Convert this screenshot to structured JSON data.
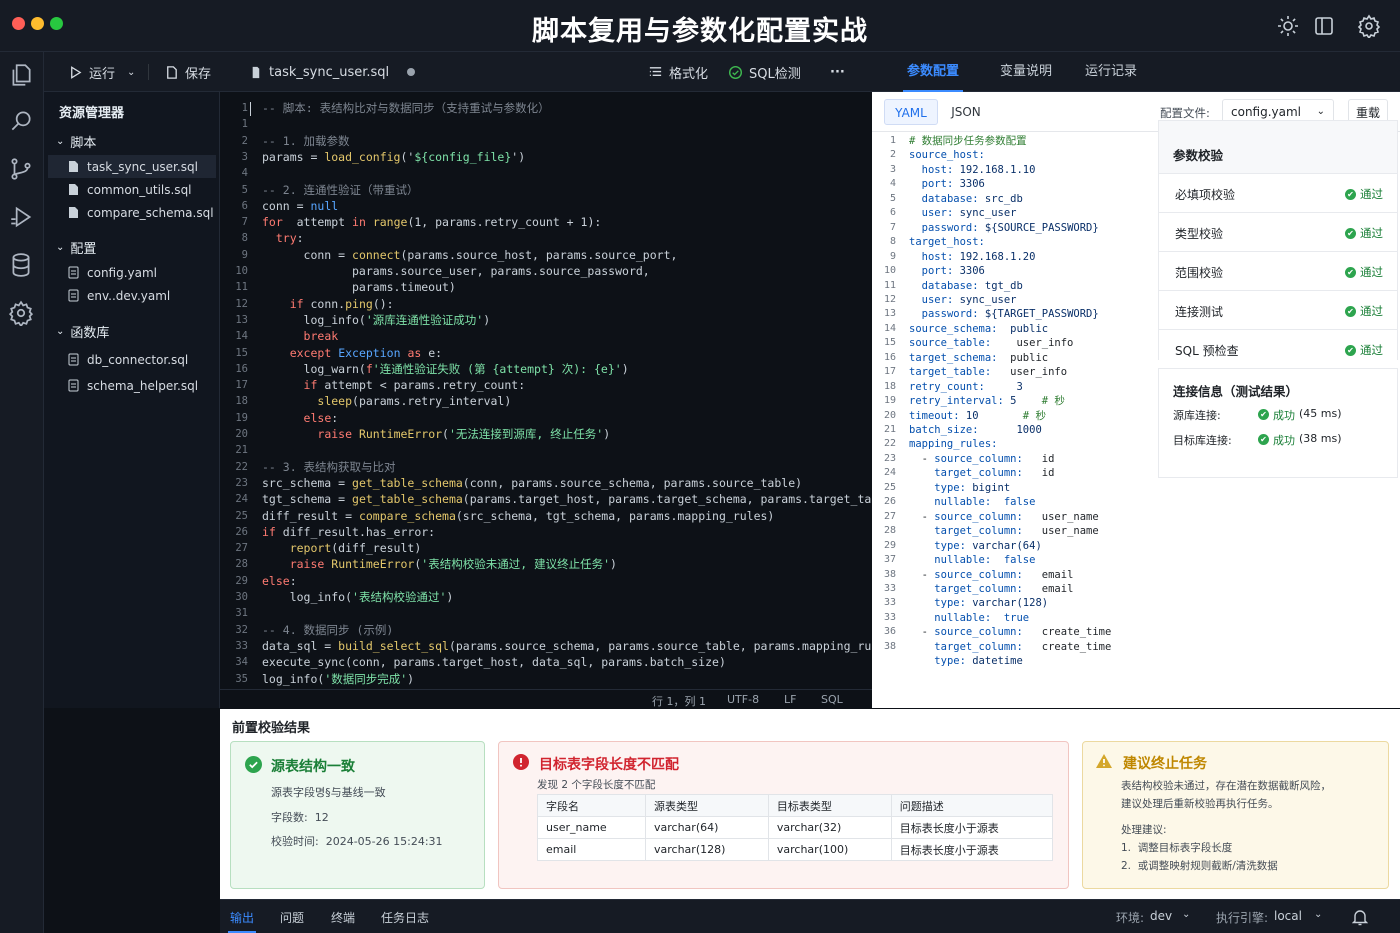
{
  "window": {
    "title": "脚本复用与参数化配置实战"
  },
  "colors": {
    "accent": "#3b8bff",
    "success": "#1a7f37",
    "error": "#d1242f",
    "warning": "#bf8700"
  },
  "toolbar": {
    "run_label": "运行",
    "save_label": "保存",
    "file_tab": "task_sync_user.sql",
    "format_label": "格式化",
    "sql_check_label": "SQL检测",
    "more_label": "···"
  },
  "right_tabs": [
    "参数配置",
    "变量说明",
    "运行记录"
  ],
  "sidebar": {
    "title": "资源管理器",
    "groups": [
      {
        "label": "脚本",
        "items": [
          "task_sync_user.sql",
          "common_utils.sql",
          "compare_schema.sql"
        ]
      },
      {
        "label": "配置",
        "items": [
          "config.yaml",
          "env..dev.yaml"
        ]
      },
      {
        "label": "函数库",
        "items": [
          "db_connector.sql",
          "schema_helper.sql"
        ]
      }
    ]
  },
  "editor": {
    "lines": [
      [
        [
          "c-com",
          "-- 脚本: 表结构比对与数据同步（支持重试与参数化）"
        ]
      ],
      [],
      [
        [
          "c-com",
          "-- 1. 加载参数"
        ]
      ],
      [
        [
          "",
          "params = "
        ],
        [
          "c-fn",
          "load_config"
        ],
        [
          "",
          "('"
        ],
        [
          "c-str",
          "${config_file}"
        ],
        [
          "",
          "')"
        ]
      ],
      [],
      [
        [
          "c-com",
          "-- 2. 连通性验证（带重试）"
        ]
      ],
      [
        [
          "",
          "conn = "
        ],
        [
          "c-bl",
          "null"
        ]
      ],
      [
        [
          "c-kw",
          "for"
        ],
        [
          "",
          "  attempt "
        ],
        [
          "c-kw",
          "in"
        ],
        [
          "",
          ""
        ],
        [
          "c-fn",
          " range"
        ],
        [
          "",
          "(1, params.retry_count + 1):"
        ]
      ],
      [
        [
          "",
          "  "
        ],
        [
          "c-kw",
          "try"
        ],
        [
          "",
          ":"
        ]
      ],
      [
        [
          "",
          "      conn = "
        ],
        [
          "c-fn",
          "connect"
        ],
        [
          "",
          "(params.source_host, params.source_port,"
        ]
      ],
      [
        [
          "",
          "             params.source_user, params.source_password,"
        ]
      ],
      [
        [
          "",
          "             params.timeout)"
        ]
      ],
      [
        [
          "",
          "    "
        ],
        [
          "c-kw",
          "if"
        ],
        [
          "",
          " conn."
        ],
        [
          "c-fn",
          "ping"
        ],
        [
          "",
          "():"
        ]
      ],
      [
        [
          "",
          "      log_info("
        ],
        [
          "c-str",
          "'源库连通性验证成功'"
        ],
        [
          "",
          ")"
        ]
      ],
      [
        [
          "",
          "      "
        ],
        [
          "c-kw",
          "break"
        ]
      ],
      [
        [
          "",
          "    "
        ],
        [
          "c-kw",
          "except"
        ],
        [
          "",
          " "
        ],
        [
          "c-bl",
          "Exception"
        ],
        [
          "",
          " "
        ],
        [
          "c-kw",
          "as"
        ],
        [
          "",
          " e:"
        ]
      ],
      [
        [
          "",
          "      log_warn("
        ],
        [
          "c-kw",
          "f"
        ],
        [
          "c-str",
          "'连通性验证失败 (第 {attempt} 次): {e}'"
        ],
        [
          "",
          ")"
        ]
      ],
      [
        [
          "",
          "      "
        ],
        [
          "c-kw",
          "if"
        ],
        [
          "",
          " attempt < params.retry_count:"
        ]
      ],
      [
        [
          "",
          "        "
        ],
        [
          "c-fn",
          "sleep"
        ],
        [
          "",
          "(params.retry_interval)"
        ]
      ],
      [
        [
          "",
          "      "
        ],
        [
          "c-kw",
          "else"
        ],
        [
          "",
          ":"
        ]
      ],
      [
        [
          "",
          "        "
        ],
        [
          "c-kw",
          "raise"
        ],
        [
          "",
          " "
        ],
        [
          "c-fn",
          "RuntimeError"
        ],
        [
          "",
          "("
        ],
        [
          "c-str",
          "'无法连接到源库, 终止任务'"
        ],
        [
          "",
          ")"
        ]
      ],
      [],
      [
        [
          "c-com",
          "-- 3. 表结构获取与比对"
        ]
      ],
      [
        [
          "",
          "src_schema = "
        ],
        [
          "c-fn",
          "get_table_schema"
        ],
        [
          "",
          "(conn, params.source_schema, params.source_table)"
        ]
      ],
      [
        [
          "",
          "tgt_schema = "
        ],
        [
          "c-fn",
          "get_table_schema"
        ],
        [
          "",
          "(params.target_host, params.target_schema, params.target_table)"
        ]
      ],
      [
        [
          "",
          "diff_result = "
        ],
        [
          "c-fn",
          "compare_schema"
        ],
        [
          "",
          "(src_schema, tgt_schema, params.mapping_rules)"
        ]
      ],
      [
        [
          "c-kw",
          "if"
        ],
        [
          "",
          " diff_result.has_error:"
        ]
      ],
      [
        [
          "",
          "    "
        ],
        [
          "c-fn",
          "report"
        ],
        [
          "",
          "(diff_result)"
        ]
      ],
      [
        [
          "",
          "    "
        ],
        [
          "c-kw",
          "raise"
        ],
        [
          "",
          " "
        ],
        [
          "c-fn",
          "RuntimeError"
        ],
        [
          "",
          "("
        ],
        [
          "c-str",
          "'表结构校验未通过, 建议终止任务'"
        ],
        [
          "",
          ")"
        ]
      ],
      [
        [
          "c-kw",
          "else"
        ],
        [
          "",
          ":"
        ]
      ],
      [
        [
          "",
          "    log_info("
        ],
        [
          "c-str",
          "'表结构校验通过'"
        ],
        [
          "",
          ")"
        ]
      ],
      [],
      [
        [
          "c-com",
          "-- 4. 数据同步 (示例)"
        ]
      ],
      [
        [
          "",
          "data_sql = "
        ],
        [
          "c-fn",
          "build_select_sql"
        ],
        [
          "",
          "(params.source_schema, params.source_table, params.mapping_rules)"
        ]
      ],
      [
        [
          "",
          "execute_sync(conn, params.target_host, data_sql, params.batch_size)"
        ]
      ],
      [
        [
          "",
          "log_info("
        ],
        [
          "c-str",
          "'数据同步完成'"
        ],
        [
          "",
          ")"
        ]
      ]
    ],
    "line_numbers": [
      "1",
      "1",
      "2",
      "3",
      "4",
      "5",
      "6",
      "7",
      "8",
      "9",
      "10",
      "11",
      "12",
      "13",
      "14",
      "15",
      "16",
      "17",
      "18",
      "19",
      "20",
      "21",
      "22",
      "23",
      "24",
      "25",
      "26",
      "27",
      "28",
      "29",
      "30",
      "31",
      "32",
      "33",
      "34",
      "35"
    ]
  },
  "statusbar": {
    "position": "行 1，列 1",
    "encoding": "UTF-8",
    "eol": "LF",
    "language": "SQL"
  },
  "config": {
    "mode_yaml": "YAML",
    "mode_json": "JSON",
    "file_label": "配置文件:",
    "file_value": "config.yaml",
    "reload_label": "重载",
    "yaml_lines": [
      [
        [
          "y-com",
          "# 数据同步任务参数配置"
        ]
      ],
      [
        [
          "y-key",
          "source_host:"
        ]
      ],
      [
        [
          "",
          "  "
        ],
        [
          "y-key",
          "host:"
        ],
        [
          "",
          ""
        ],
        [
          "y-num",
          " 192.168.1.10"
        ]
      ],
      [
        [
          "",
          "  "
        ],
        [
          "y-key",
          "port:"
        ],
        [
          "y-num",
          " 3306"
        ]
      ],
      [
        [
          "",
          "  "
        ],
        [
          "y-key",
          "database:"
        ],
        [
          "y-val",
          " src_db"
        ]
      ],
      [
        [
          "",
          "  "
        ],
        [
          "y-key",
          "user:"
        ],
        [
          "y-val",
          " sync_user"
        ]
      ],
      [
        [
          "",
          "  "
        ],
        [
          "y-key",
          "password:"
        ],
        [
          "y-val",
          " ${SOURCE_PASSWORD}"
        ]
      ],
      [
        [
          "y-key",
          "target_host:"
        ]
      ],
      [
        [
          "",
          "  "
        ],
        [
          "y-key",
          "host:"
        ],
        [
          "y-num",
          " 192.168.1.20"
        ]
      ],
      [
        [
          "",
          "  "
        ],
        [
          "y-key",
          "port:"
        ],
        [
          "y-num",
          " 3306"
        ]
      ],
      [
        [
          "",
          "  "
        ],
        [
          "y-key",
          "database:"
        ],
        [
          "y-val",
          " tgt_db"
        ]
      ],
      [
        [
          "",
          "  "
        ],
        [
          "y-key",
          "user:"
        ],
        [
          "y-val",
          " sync_user"
        ]
      ],
      [
        [
          "",
          "  "
        ],
        [
          "y-key",
          "password:"
        ],
        [
          "y-val",
          " ${TARGET_PASSWORD}"
        ]
      ],
      [
        [
          "y-key",
          "source_schema:"
        ],
        [
          "y-val",
          "  public"
        ]
      ],
      [
        [
          "y-key",
          "source_table:"
        ],
        [
          "",
          "    user_info"
        ]
      ],
      [
        [
          "y-key",
          "target_schema:"
        ],
        [
          "",
          "  public"
        ]
      ],
      [
        [
          "y-key",
          "target_table:"
        ],
        [
          "",
          "   user_info"
        ]
      ],
      [
        [
          "y-key",
          "retry_count:"
        ],
        [
          "y-num",
          "     3"
        ]
      ],
      [
        [
          "y-key",
          "retry_interval:"
        ],
        [
          "y-num",
          " 5"
        ],
        [
          "y-com",
          "    # 秒"
        ]
      ],
      [
        [
          "y-key",
          "timeout:"
        ],
        [
          "y-num",
          " 10"
        ],
        [
          "y-com",
          "       # 秒"
        ]
      ],
      [
        [
          "y-key",
          "batch_size:"
        ],
        [
          "y-num",
          "      1000"
        ]
      ],
      [
        [
          "y-key",
          "mapping_rules:"
        ]
      ],
      [
        [
          "",
          "  - "
        ],
        [
          "y-key",
          "source_column:"
        ],
        [
          "",
          "   id"
        ]
      ],
      [
        [
          "",
          "    "
        ],
        [
          "y-key",
          "target_column:"
        ],
        [
          "",
          "   id"
        ]
      ],
      [
        [
          "",
          "    "
        ],
        [
          "y-key",
          "type:"
        ],
        [
          "y-val",
          " bigint"
        ]
      ],
      [
        [
          "",
          "    "
        ],
        [
          "y-key",
          "nullable:"
        ],
        [
          "y-bool",
          "  false"
        ]
      ],
      [
        [
          "",
          "  - "
        ],
        [
          "y-key",
          "source_column:"
        ],
        [
          "",
          "   user_name"
        ]
      ],
      [
        [
          "",
          "    "
        ],
        [
          "y-key",
          "target_column:"
        ],
        [
          "",
          "   user_name"
        ]
      ],
      [
        [
          "",
          "    "
        ],
        [
          "y-key",
          "type:"
        ],
        [
          "y-val",
          " varchar(64)"
        ]
      ],
      [
        [
          "",
          "    "
        ],
        [
          "y-key",
          "nullable:"
        ],
        [
          "y-bool",
          "  false"
        ]
      ],
      [
        [
          "",
          "  - "
        ],
        [
          "y-key",
          "source_column:"
        ],
        [
          "",
          "   email"
        ]
      ],
      [
        [
          "",
          "    "
        ],
        [
          "y-key",
          "target_column:"
        ],
        [
          "",
          "   email"
        ]
      ],
      [
        [
          "",
          "    "
        ],
        [
          "y-key",
          "type:"
        ],
        [
          "y-val",
          " varchar(128)"
        ]
      ],
      [
        [
          "",
          "    "
        ],
        [
          "y-key",
          "nullable:"
        ],
        [
          "y-bool",
          "  true"
        ]
      ],
      [
        [
          "",
          "  - "
        ],
        [
          "y-key",
          "source_column:"
        ],
        [
          "",
          "   create_time"
        ]
      ],
      [
        [
          "",
          "    "
        ],
        [
          "y-key",
          "target_column:"
        ],
        [
          "",
          "   create_time"
        ]
      ],
      [
        [
          "",
          "    "
        ],
        [
          "y-key",
          "type:"
        ],
        [
          "y-val",
          " datetime"
        ]
      ]
    ],
    "yaml_line_numbers": [
      "1",
      "2",
      "3",
      "4",
      "5",
      "6",
      "7",
      "8",
      "9",
      "10",
      "11",
      "12",
      "13",
      "14",
      "15",
      "16",
      "17",
      "18",
      "19",
      "20",
      "21",
      "22",
      "23",
      "24",
      "25",
      "26",
      "27",
      "28",
      "29",
      "37",
      "38",
      "33",
      "33",
      "33",
      "36",
      "38"
    ],
    "checks_title": "参数校验",
    "checks": [
      {
        "label": "必填项校验",
        "status": "通过"
      },
      {
        "label": "类型校验",
        "status": "通过"
      },
      {
        "label": "范围校验",
        "status": "通过"
      },
      {
        "label": "连接测试",
        "status": "通过"
      },
      {
        "label": "SQL 预检查",
        "status": "通过"
      }
    ],
    "conn_title": "连接信息（测试结果）",
    "conn": [
      {
        "label": "源库连接:",
        "status": "成功",
        "time": "(45 ms)"
      },
      {
        "label": "目标库连接:",
        "status": "成功",
        "time": "(38 ms)"
      }
    ]
  },
  "results": {
    "title": "前置校验结果",
    "card1": {
      "title": "源表结构一致",
      "desc": "源表字段명§与基线一致",
      "count": "字段数:  12",
      "time": "校验时间:  2024-05-26 15:24:31"
    },
    "card2": {
      "title": "目标表字段长度不匹配",
      "desc": "发现 2 个字段长度不匹配",
      "headers": [
        "字段名",
        "源表类型",
        "目标表类型",
        "问题描述"
      ],
      "rows": [
        [
          "user_name",
          "varchar(64)",
          "varchar(32)",
          "目标表长度小于源表"
        ],
        [
          "email",
          "varchar(128)",
          "varchar(100)",
          "目标表长度小于源表"
        ]
      ]
    },
    "card3": {
      "title": "建议终止任务",
      "desc1": "表结构校验未通过，存在潜在数据截断风险，",
      "desc2": "建议处理后重新校验再执行任务。",
      "sug_title": "处理建议:",
      "sug1": "1.  调整目标表字段长度",
      "sug2": "2.  或调整映射规则截断/清洗数据"
    }
  },
  "footer": {
    "tabs": [
      "输出",
      "问题",
      "终端",
      "任务日志"
    ],
    "env_label": "环境:",
    "env_value": "dev",
    "engine_label": "执行引擎:",
    "engine_value": "local"
  }
}
